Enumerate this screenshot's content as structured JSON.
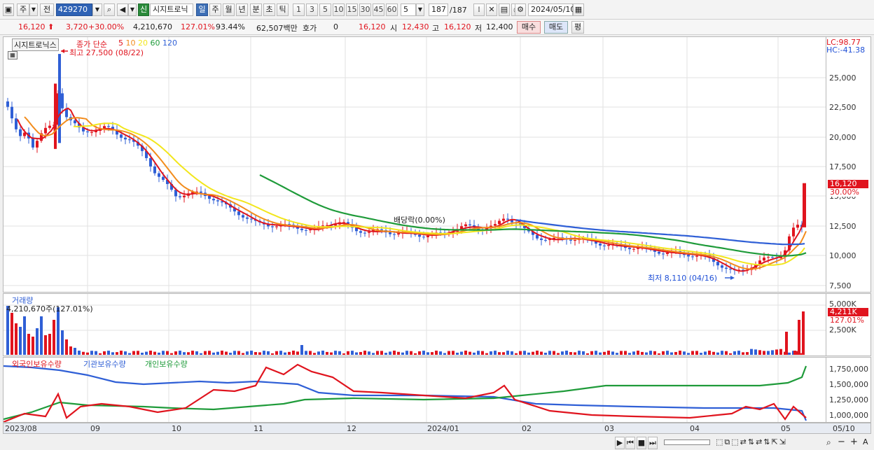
{
  "toolbar": {
    "type_label": "주",
    "prev_label": "전",
    "stock_code": "429270",
    "new_badge": "신",
    "stock_name": "시지트로닉",
    "periods": [
      "일",
      "주",
      "월",
      "년",
      "분",
      "초",
      "틱"
    ],
    "active_period": "일",
    "intervals": [
      "1",
      "3",
      "5",
      "10",
      "15",
      "30",
      "45",
      "60"
    ],
    "interval_value": "5",
    "count_display": "187",
    "count_total": "/187",
    "date": "2024/05/10"
  },
  "quote": {
    "price": "16,120",
    "change": "3,720",
    "change_pct": "+30.00%",
    "volume": "4,210,670",
    "volume_ratio": "127.01%",
    "turnover": "93.44%",
    "amount": "62,507백만",
    "hoga_label": "호가",
    "hoga_value": "0",
    "hoga_price": "16,120",
    "open_label": "시",
    "open": "12,430",
    "high_label": "고",
    "high": "16,120",
    "low_label": "저",
    "low": "12,400",
    "buy_label": "매수",
    "sell_label": "매도",
    "eval_label": "평"
  },
  "price_panel": {
    "name_box": "시지트로닉스",
    "ma_label": "종가 단순",
    "ma_periods": [
      {
        "period": "5",
        "color": "#e0141e"
      },
      {
        "period": "10",
        "color": "#f28c1c"
      },
      {
        "period": "20",
        "color": "#f2e61c"
      },
      {
        "period": "60",
        "color": "#1f9b3a"
      },
      {
        "period": "120",
        "color": "#2f5fd6"
      }
    ],
    "high_note": "최고 27,500 (08/22)",
    "low_note": "최저 8,110 (04/16)",
    "dividend_note": "배당락(0.00%)",
    "lc": "LC:98.77",
    "hc": "HC:-41.38",
    "y_ticks": [
      "25,000",
      "22,500",
      "20,000",
      "17,500",
      "15,000",
      "12,500",
      "10,000",
      "7,500"
    ],
    "current_tag": "16,120",
    "current_pct_tag": "30.00%"
  },
  "volume_panel": {
    "title": "거래량",
    "value_label": "4,210,670주(127.01%)",
    "y_ticks": [
      "5,000K",
      "2,500K"
    ],
    "current_tag": "4,211K",
    "current_pct_tag": "127.01%"
  },
  "holding_panel": {
    "series": [
      {
        "name": "외국인보유수량",
        "color": "#e0141e"
      },
      {
        "name": "기관보유수량",
        "color": "#2f5fd6"
      },
      {
        "name": "개인보유수량",
        "color": "#1f9b3a"
      }
    ],
    "y_ticks": [
      "1,750,000",
      "1,500,000",
      "1,250,000",
      "1,000,000"
    ]
  },
  "x_axis": {
    "labels": [
      "2023/08",
      "09",
      "10",
      "11",
      "12",
      "2024/01",
      "02",
      "03",
      "04",
      "05"
    ],
    "current_label": "05/10"
  },
  "chart_data": {
    "type": "candlestick",
    "x_range": [
      "2023/08",
      "2024/05/10"
    ],
    "ylim": [
      7500,
      27500
    ],
    "last_close": 16120,
    "high": {
      "value": 27500,
      "date": "08/22"
    },
    "low": {
      "value": 8110,
      "date": "04/16"
    },
    "volume_last": 4210670,
    "holding_series": [
      "외국인보유수량",
      "기관보유수량",
      "개인보유수량"
    ]
  }
}
